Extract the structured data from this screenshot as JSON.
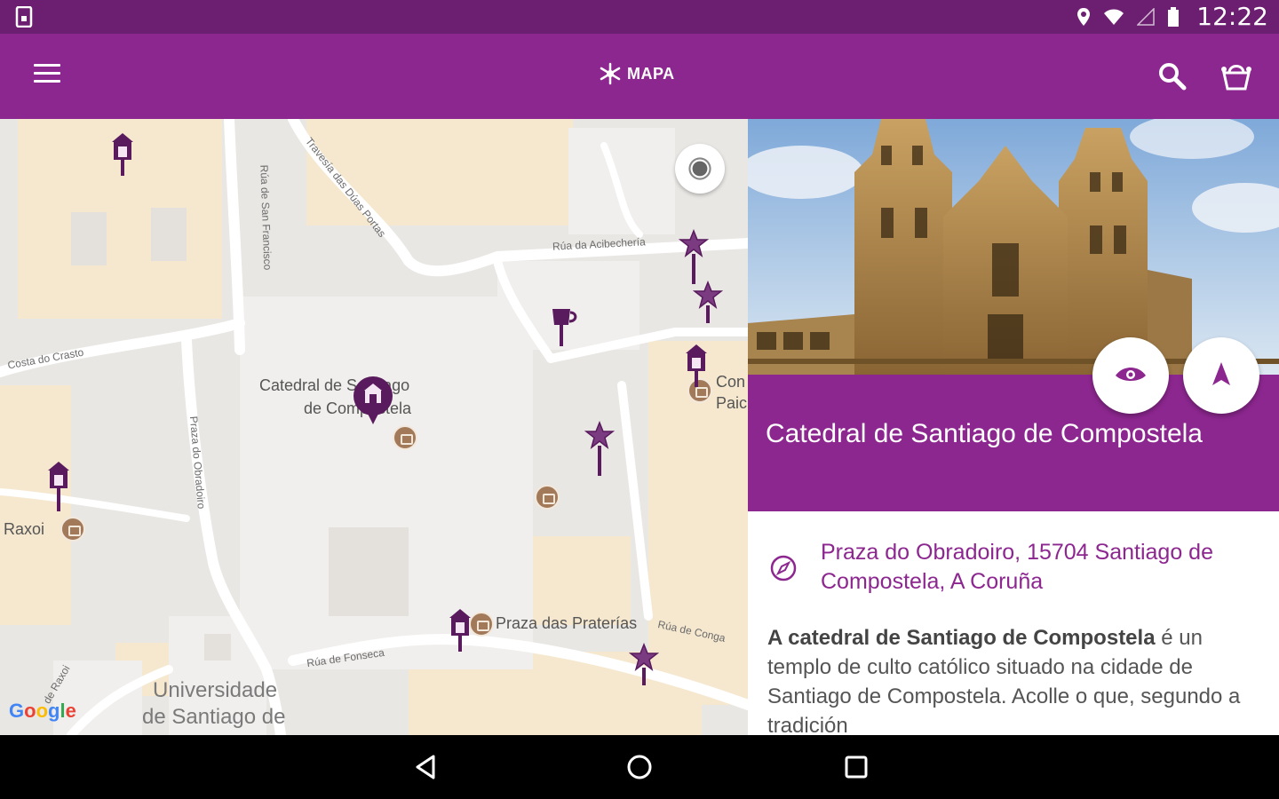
{
  "status_bar": {
    "time": "12:22",
    "icons": [
      "sim-card-icon",
      "location-icon",
      "wifi-icon",
      "signal-icon",
      "battery-icon"
    ]
  },
  "app_bar": {
    "title": "MAPA",
    "icons": [
      "menu-icon",
      "asterisk-logo-icon",
      "search-icon",
      "basket-icon"
    ],
    "colors": {
      "status": "#6c1f70",
      "bar": "#8d2790"
    }
  },
  "map": {
    "street_labels": {
      "rua_san_francisco": "Rúa de San Francisco",
      "travesa": "Travesía das Dúas Portas",
      "rua_acibecheria": "Rúa da Acibechería",
      "costa_crasto": "Costa do Crasto",
      "rua_obradoiro": "Praza do Obradoiro",
      "rua_fonseca": "Rúa de Fonseca",
      "rua_conga": "Rúa de Conga",
      "rua_raxoi": "de Raxoi"
    },
    "place_labels": {
      "catedral_line1": "Catedral de Santiago",
      "catedral_line2": "de Compostela",
      "raxoi": "Raxoi",
      "praterias": "Praza das Praterías",
      "universidade_line1": "Universidade",
      "universidade_line2": "de Santiago de",
      "con_line1": "Con",
      "con_line2": "Paic"
    },
    "attribution": "Google"
  },
  "detail": {
    "title": "Catedral de Santiago de Compostela",
    "address": "Praza do Obradoiro, 15704 Santiago de Compostela, A Coruña",
    "description_bold": "A catedral de Santiago de Compostela",
    "description_rest": " é un templo de culto católico situado na cidade de Santiago de Compostela. Acolle o que, segundo a tradición",
    "hero_image": "cathedral-photo",
    "accent_color": "#8d2790"
  },
  "nav_bar": {
    "icons": [
      "back-icon",
      "home-icon",
      "recents-icon"
    ]
  }
}
